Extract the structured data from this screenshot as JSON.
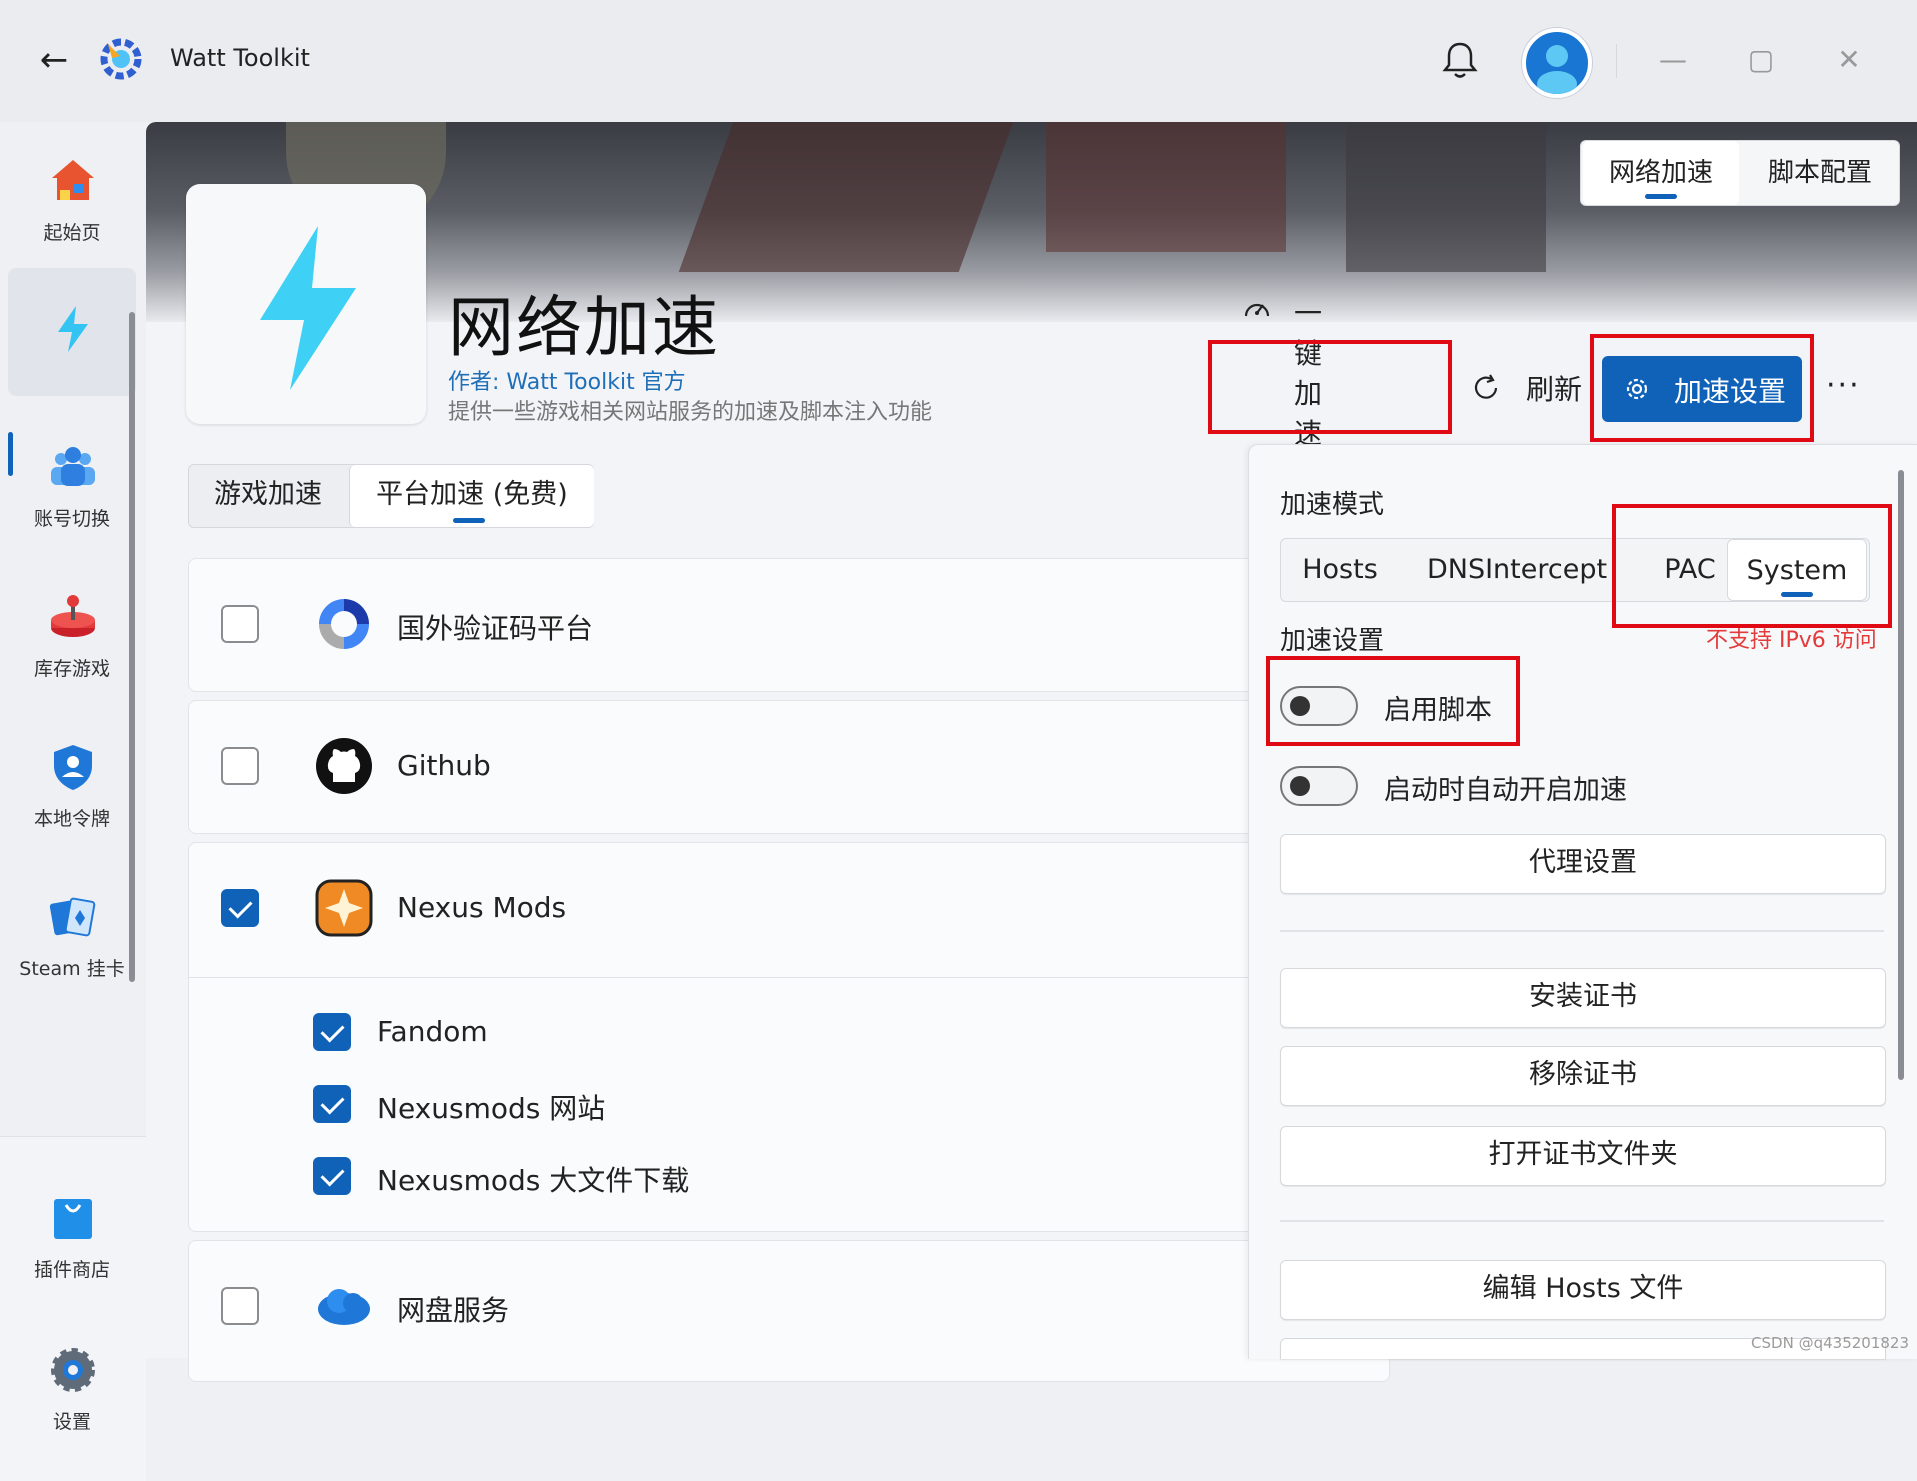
{
  "window": {
    "title": "Watt Toolkit",
    "back_icon": "arrow-left-icon",
    "controls": [
      "minimize-icon",
      "maximize-icon",
      "close-icon"
    ]
  },
  "sidebar": {
    "items": [
      {
        "label": "起始页",
        "icon": "home-icon"
      },
      {
        "label": "",
        "icon": "lightning-icon",
        "active": true
      },
      {
        "label": "账号切换",
        "icon": "people-icon"
      },
      {
        "label": "库存游戏",
        "icon": "joystick-icon"
      },
      {
        "label": "本地令牌",
        "icon": "shield-user-icon"
      },
      {
        "label": "Steam 挂卡",
        "icon": "cards-icon"
      },
      {
        "label": "插件商店",
        "icon": "shopping-bag-icon"
      },
      {
        "label": "设置",
        "icon": "gear-icon"
      }
    ]
  },
  "header": {
    "tabs": [
      {
        "label": "网络加速",
        "selected": true
      },
      {
        "label": "脚本配置",
        "selected": false
      }
    ],
    "title": "网络加速",
    "author": "作者:  Watt Toolkit  官方",
    "description": "提供一些游戏相关网站服务的加速及脚本注入功能",
    "actions": {
      "one_click": "一键加速",
      "refresh": "刷新",
      "settings": "加速设置",
      "more": "···"
    }
  },
  "tabs": [
    {
      "label": "游戏加速",
      "selected": false
    },
    {
      "label": "平台加速 (免费)",
      "selected": true
    }
  ],
  "services": [
    {
      "name": "国外验证码平台",
      "checked": false,
      "icon": "recaptcha-icon"
    },
    {
      "name": "Github",
      "checked": false,
      "icon": "github-icon"
    },
    {
      "name": "Nexus Mods",
      "checked": true,
      "icon": "nexus-mods-icon",
      "children": [
        {
          "name": "Fandom",
          "checked": true
        },
        {
          "name": "Nexusmods 网站",
          "checked": true
        },
        {
          "name": "Nexusmods 大文件下载",
          "checked": true
        }
      ]
    },
    {
      "name": "网盘服务",
      "checked": false,
      "icon": "cloud-drive-icon"
    }
  ],
  "panel": {
    "mode_label": "加速模式",
    "modes": [
      {
        "label": "Hosts",
        "selected": false
      },
      {
        "label": "DNSIntercept",
        "selected": false
      },
      {
        "label": "PAC",
        "selected": false
      },
      {
        "label": "System",
        "selected": true
      }
    ],
    "settings_label": "加速设置",
    "warning": "不支持 IPv6 访问",
    "toggles": [
      {
        "label": "启用脚本",
        "on": false
      },
      {
        "label": "启动时自动开启加速",
        "on": false
      }
    ],
    "buttons": {
      "proxy": "代理设置",
      "install_cert": "安装证书",
      "remove_cert": "移除证书",
      "open_cert_folder": "打开证书文件夹",
      "edit_hosts": "编辑 Hosts 文件"
    }
  },
  "watermark": "CSDN @q435201823",
  "colors": {
    "accent": "#0f62b8",
    "highlight": "#e00a15",
    "warning": "#e33a3a"
  }
}
